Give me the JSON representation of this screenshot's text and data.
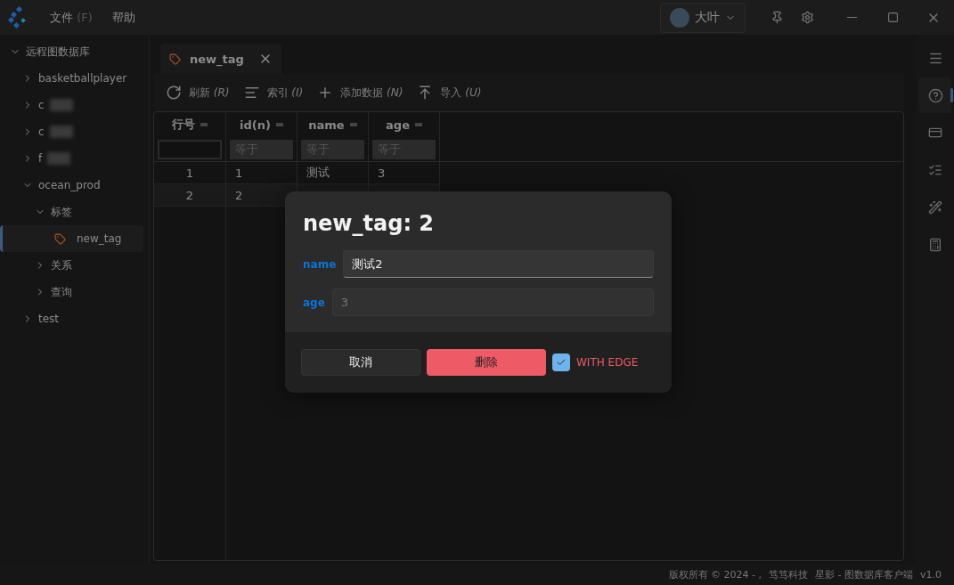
{
  "menu": [
    {
      "label": "文件",
      "shortcut": "(F)"
    },
    {
      "label": "帮助"
    }
  ],
  "user": {
    "name": "大叶"
  },
  "tree": [
    {
      "label": "远程图数据库",
      "expanded": true,
      "children": [
        {
          "label": "basketballplayer",
          "expanded": false,
          "blurred": false
        },
        {
          "label": "c",
          "expanded": false,
          "blurred": true
        },
        {
          "label": "c",
          "expanded": false,
          "blurred": true
        },
        {
          "label": "f",
          "expanded": false,
          "blurred": true
        },
        {
          "label": "ocean_prod",
          "expanded": true,
          "children": [
            {
              "label": "标签",
              "expanded": true,
              "children": [
                {
                  "label": "new_tag",
                  "kind": "tag",
                  "selected": true
                }
              ]
            },
            {
              "label": "关系",
              "expanded": false
            },
            {
              "label": "查询",
              "expanded": false
            }
          ]
        },
        {
          "label": "test",
          "expanded": false
        }
      ]
    }
  ],
  "tab": {
    "label": "new_tag"
  },
  "toolbar": [
    {
      "label": "刷新",
      "key": "(R)",
      "kind": "refresh"
    },
    {
      "label": "索引",
      "key": "(I)",
      "kind": "index"
    },
    {
      "label": "添加数据",
      "key": "(N)",
      "kind": "add"
    },
    {
      "label": "导入",
      "key": "(U)",
      "kind": "import"
    }
  ],
  "table": {
    "columns": [
      "行号",
      "id(n)",
      "name",
      "age"
    ],
    "filters": [
      {
        "kind": "blank"
      },
      {
        "kind": "text",
        "placeholder": "等于"
      },
      {
        "kind": "text",
        "placeholder": "等于"
      },
      {
        "kind": "text",
        "placeholder": "等于"
      }
    ],
    "rows": [
      [
        "1",
        "1",
        "测试",
        "3"
      ],
      [
        "2",
        "2"
      ]
    ]
  },
  "dialog": {
    "title": "new_tag: 2",
    "fields": [
      {
        "label": "name",
        "value": "测试2",
        "focused": true
      },
      {
        "label": "age",
        "value": "3",
        "focused": false
      }
    ],
    "cancel": "取消",
    "delete": "删除",
    "with_edge": {
      "label": "WITH EDGE",
      "checked": true
    }
  },
  "status_bar": {
    "copyright": "版权所有 © 2024 - ,",
    "company": "笃笃科技",
    "product": "星影 - 图数据库客户端",
    "version": "v1.0"
  }
}
